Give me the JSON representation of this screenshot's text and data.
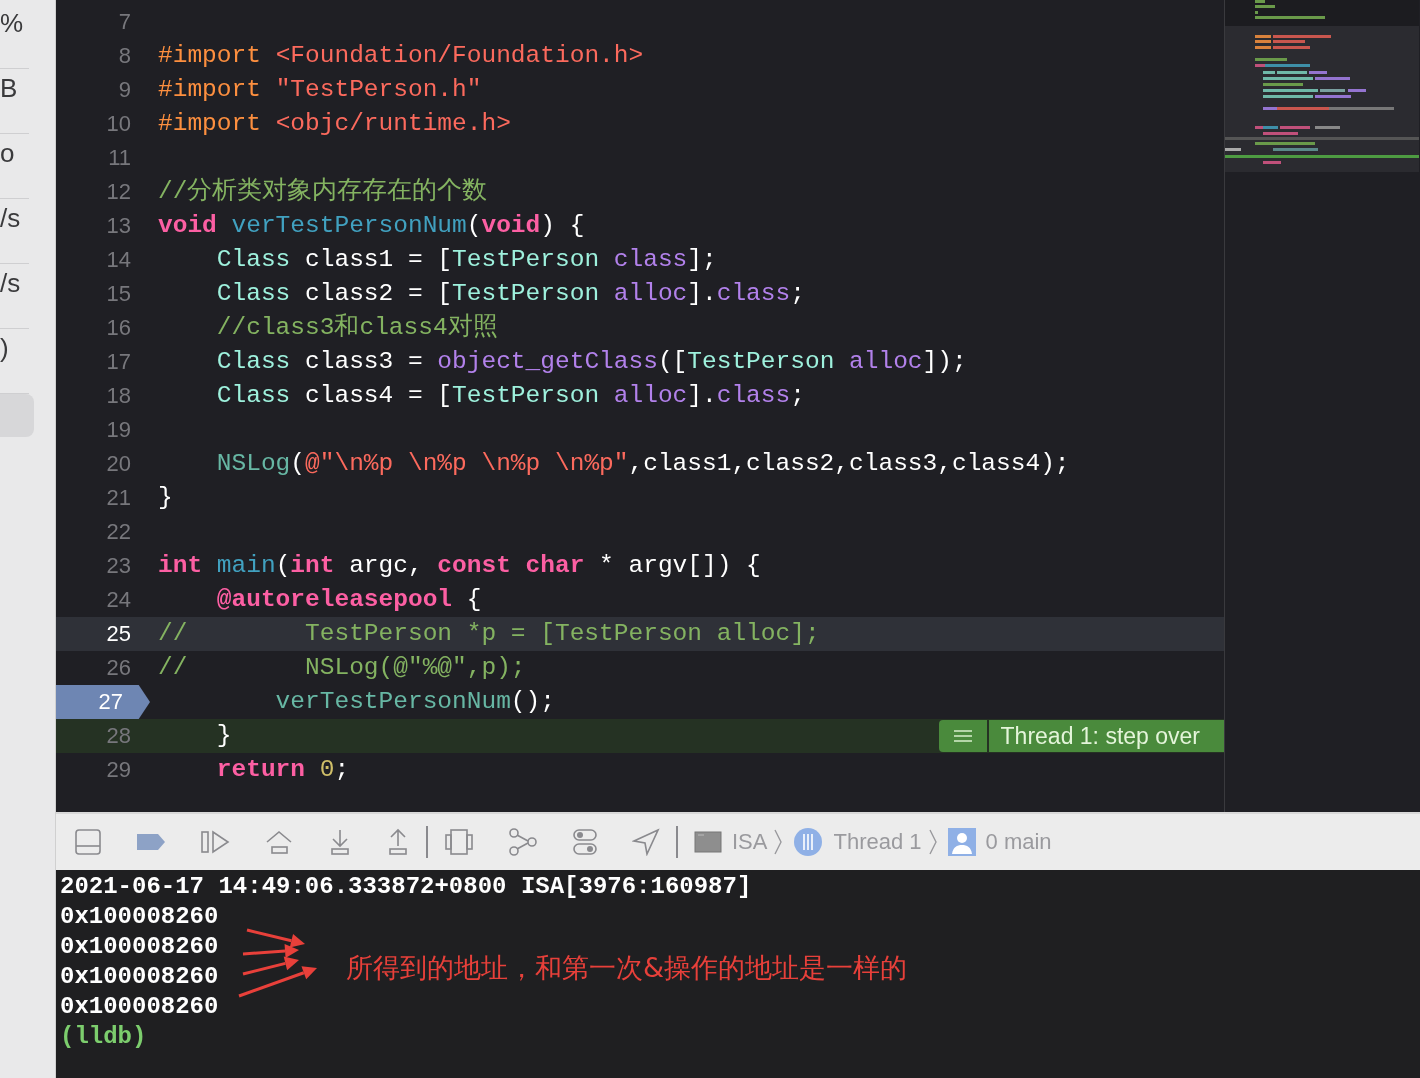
{
  "sidebar": {
    "items": [
      {
        "label": "%"
      },
      {
        "label": "B"
      },
      {
        "label": "o"
      },
      {
        "label": "/s"
      },
      {
        "label": "/s"
      },
      {
        "label": ")"
      }
    ],
    "selection_visible": true
  },
  "editor": {
    "lines": [
      {
        "number": "7",
        "kind": "plain"
      },
      {
        "number": "8",
        "kind": "plain",
        "tokens": [
          {
            "kind": "pre",
            "text": "#import "
          },
          {
            "kind": "str",
            "text": "<Foundation/Foundation.h>"
          }
        ]
      },
      {
        "number": "9",
        "kind": "plain",
        "tokens": [
          {
            "kind": "pre",
            "text": "#import "
          },
          {
            "kind": "str",
            "text": "\"TestPerson.h\""
          }
        ]
      },
      {
        "number": "10",
        "kind": "plain",
        "tokens": [
          {
            "kind": "pre",
            "text": "#import "
          },
          {
            "kind": "str",
            "text": "<objc/runtime.h>"
          }
        ]
      },
      {
        "number": "11",
        "kind": "plain"
      },
      {
        "number": "12",
        "kind": "plain",
        "tokens": [
          {
            "kind": "comment",
            "text": "//分析类对象内存存在的个数"
          }
        ]
      },
      {
        "number": "13",
        "kind": "plain",
        "tokens": [
          {
            "kind": "kw",
            "text": "void "
          },
          {
            "kind": "decl",
            "text": "verTestPersonNum"
          },
          {
            "kind": "plain",
            "text": "("
          },
          {
            "kind": "kw",
            "text": "void"
          },
          {
            "kind": "plain",
            "text": ") {"
          }
        ]
      },
      {
        "number": "14",
        "kind": "plain",
        "tokens": [
          {
            "kind": "type",
            "text": "    Class"
          },
          {
            "kind": "plain",
            "text": " class1 = ["
          },
          {
            "kind": "type",
            "text": "TestPerson "
          },
          {
            "kind": "method",
            "text": "class"
          },
          {
            "kind": "plain",
            "text": "];"
          }
        ]
      },
      {
        "number": "15",
        "kind": "plain",
        "tokens": [
          {
            "kind": "type",
            "text": "    Class"
          },
          {
            "kind": "plain",
            "text": " class2 = ["
          },
          {
            "kind": "type",
            "text": "TestPerson "
          },
          {
            "kind": "method",
            "text": "alloc"
          },
          {
            "kind": "plain",
            "text": "]."
          },
          {
            "kind": "method",
            "text": "class"
          },
          {
            "kind": "plain",
            "text": ";"
          }
        ]
      },
      {
        "number": "16",
        "kind": "plain",
        "tokens": [
          {
            "kind": "comment",
            "text": "    //class3和class4对照"
          }
        ]
      },
      {
        "number": "17",
        "kind": "plain",
        "tokens": [
          {
            "kind": "type",
            "text": "    Class"
          },
          {
            "kind": "plain",
            "text": " class3 = "
          },
          {
            "kind": "method",
            "text": "object_getClass"
          },
          {
            "kind": "plain",
            "text": "(["
          },
          {
            "kind": "type",
            "text": "TestPerson "
          },
          {
            "kind": "method",
            "text": "alloc"
          },
          {
            "kind": "plain",
            "text": "]);"
          }
        ]
      },
      {
        "number": "18",
        "kind": "plain",
        "tokens": [
          {
            "kind": "type",
            "text": "    Class"
          },
          {
            "kind": "plain",
            "text": " class4 = ["
          },
          {
            "kind": "type",
            "text": "TestPerson "
          },
          {
            "kind": "method",
            "text": "alloc"
          },
          {
            "kind": "plain",
            "text": "]."
          },
          {
            "kind": "method",
            "text": "class"
          },
          {
            "kind": "plain",
            "text": ";"
          }
        ]
      },
      {
        "number": "19",
        "kind": "plain"
      },
      {
        "number": "20",
        "kind": "plain",
        "tokens": [
          {
            "kind": "call",
            "text": "    NSLog"
          },
          {
            "kind": "plain",
            "text": "("
          },
          {
            "kind": "str",
            "text": "@\"\\n%p \\n%p \\n%p \\n%p\""
          },
          {
            "kind": "plain",
            "text": ",class1,class2,class3,class4);"
          }
        ]
      },
      {
        "number": "21",
        "kind": "plain",
        "tokens": [
          {
            "kind": "plain",
            "text": "}"
          }
        ]
      },
      {
        "number": "22",
        "kind": "plain"
      },
      {
        "number": "23",
        "kind": "plain",
        "tokens": [
          {
            "kind": "kw",
            "text": "int "
          },
          {
            "kind": "decl",
            "text": "main"
          },
          {
            "kind": "plain",
            "text": "("
          },
          {
            "kind": "kw",
            "text": "int"
          },
          {
            "kind": "plain",
            "text": " argc, "
          },
          {
            "kind": "kw",
            "text": "const char"
          },
          {
            "kind": "plain",
            "text": " * argv[]) {"
          }
        ]
      },
      {
        "number": "24",
        "kind": "plain",
        "tokens": [
          {
            "kind": "kw",
            "text": "    @autoreleasepool"
          },
          {
            "kind": "plain",
            "text": " {"
          }
        ]
      },
      {
        "number": "25",
        "kind": "cursor",
        "tokens": [
          {
            "kind": "comment",
            "text": "//        TestPerson *p = [TestPerson alloc];"
          }
        ]
      },
      {
        "number": "26",
        "kind": "plain",
        "tokens": [
          {
            "kind": "comment",
            "text": "//        NSLog(@\"%@\",p);"
          }
        ]
      },
      {
        "number": "27",
        "kind": "pc",
        "tokens": [
          {
            "kind": "call",
            "text": "        verTestPersonNum"
          },
          {
            "kind": "plain",
            "text": "();"
          }
        ]
      },
      {
        "number": "28",
        "kind": "step",
        "tokens": [
          {
            "kind": "plain",
            "text": "    }"
          }
        ],
        "annotation": {
          "text": "Thread 1: step over"
        }
      },
      {
        "number": "29",
        "kind": "plain",
        "tokens": [
          {
            "kind": "kw",
            "text": "    return "
          },
          {
            "kind": "num",
            "text": "0"
          },
          {
            "kind": "plain",
            "text": ";"
          }
        ]
      }
    ]
  },
  "debug_bar": {
    "breakpoints_active": true,
    "breadcrumb": [
      {
        "kind": "app",
        "label": "ISA"
      },
      {
        "kind": "thread",
        "label": "Thread 1"
      },
      {
        "kind": "frame",
        "label": "0 main"
      }
    ]
  },
  "console": {
    "lines": [
      {
        "kind": "output",
        "text": "2021-06-17 14:49:06.333872+0800 ISA[3976:160987]"
      },
      {
        "kind": "output",
        "text": "0x100008260"
      },
      {
        "kind": "output",
        "text": "0x100008260"
      },
      {
        "kind": "output",
        "text": "0x100008260"
      },
      {
        "kind": "output",
        "text": "0x100008260"
      },
      {
        "kind": "prompt",
        "text": "(lldb)"
      }
    ],
    "note": {
      "text": "所得到的地址，和第一次&操作的地址是一样的"
    }
  }
}
